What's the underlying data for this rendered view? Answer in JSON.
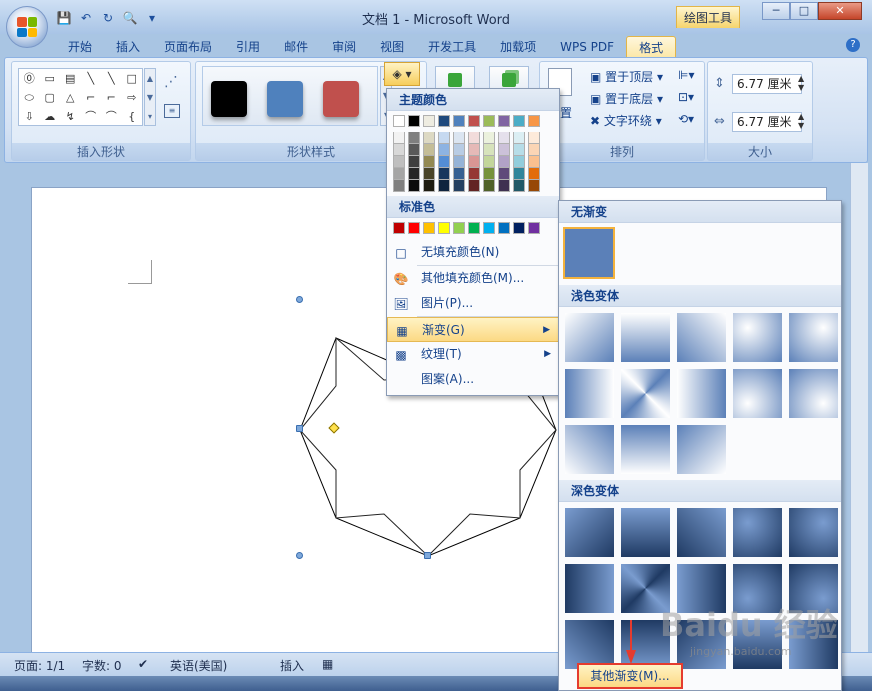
{
  "window": {
    "title": "文档 1 - Microsoft Word",
    "context_tool": "绘图工具",
    "btn_min": "─",
    "btn_max": "□",
    "btn_close": "✕"
  },
  "quick_access": [
    {
      "name": "save-icon",
      "glyph": "💾"
    },
    {
      "name": "undo-icon",
      "glyph": "↶"
    },
    {
      "name": "redo-icon",
      "glyph": "↻"
    },
    {
      "name": "print-preview-icon",
      "glyph": "🔍"
    },
    {
      "name": "qat-dropdown-icon",
      "glyph": "▾"
    }
  ],
  "tabs": [
    {
      "label": "开始",
      "active": false
    },
    {
      "label": "插入",
      "active": false
    },
    {
      "label": "页面布局",
      "active": false
    },
    {
      "label": "引用",
      "active": false
    },
    {
      "label": "邮件",
      "active": false
    },
    {
      "label": "审阅",
      "active": false
    },
    {
      "label": "视图",
      "active": false
    },
    {
      "label": "开发工具",
      "active": false
    },
    {
      "label": "加载项",
      "active": false
    },
    {
      "label": "WPS PDF",
      "active": false
    },
    {
      "label": "格式",
      "active": true
    }
  ],
  "help_label": "?",
  "ribbon": {
    "insert_shapes_label": "插入形状",
    "shape_styles_label": "形状样式",
    "arrange_label": "排列",
    "size_label": "大小",
    "shape_glyphs": [
      "⓪",
      "▭",
      "▤",
      "╲",
      "╲",
      "□",
      "⬭",
      "▢",
      "△",
      "⌐",
      "⌐",
      "⇨",
      "⇩",
      "☁",
      "↯",
      "⌒",
      "⌒",
      "{"
    ],
    "style_colors": [
      "#000000",
      "#4f81bd",
      "#c0504d"
    ],
    "bring_front": "置于顶层",
    "send_back": "置于底层",
    "text_wrap": "文字环绕",
    "position_partial": "置",
    "height_value": "6.77 厘米",
    "width_value": "6.77 厘米",
    "fill_btn_glyph": "◈ ▾"
  },
  "fill_menu": {
    "theme_colors_label": "主题颜色",
    "standard_colors_label": "标准色",
    "theme_top_row": [
      "#ffffff",
      "#000000",
      "#eeece1",
      "#1f497d",
      "#4f81bd",
      "#c0504d",
      "#9bbb59",
      "#8064a2",
      "#4bacc6",
      "#f79646"
    ],
    "theme_shades": [
      [
        "#f2f2f2",
        "#7f7f7f",
        "#ddd9c3",
        "#c6d9f0",
        "#dbe5f1",
        "#f2dcdb",
        "#ebf1dd",
        "#e5e0ec",
        "#dbeef3",
        "#fdeada"
      ],
      [
        "#d8d8d8",
        "#595959",
        "#c4bd97",
        "#8db3e2",
        "#b8cce4",
        "#e5b9b7",
        "#d7e3bc",
        "#ccc1d9",
        "#b7dde8",
        "#fbd5b5"
      ],
      [
        "#bfbfbf",
        "#3f3f3f",
        "#938953",
        "#548dd4",
        "#95b3d7",
        "#d99694",
        "#c3d69b",
        "#b2a2c7",
        "#92cddc",
        "#fac08f"
      ],
      [
        "#a5a5a5",
        "#262626",
        "#494429",
        "#17365d",
        "#366092",
        "#953734",
        "#76923c",
        "#5f497a",
        "#31859b",
        "#e36c09"
      ],
      [
        "#7f7f7f",
        "#0c0c0c",
        "#1d1b10",
        "#0f243e",
        "#244061",
        "#632423",
        "#4f6128",
        "#3f3151",
        "#205867",
        "#974806"
      ]
    ],
    "standard_colors": [
      "#c00000",
      "#ff0000",
      "#ffc000",
      "#ffff00",
      "#92d050",
      "#00b050",
      "#00b0f0",
      "#0070c0",
      "#002060",
      "#7030a0"
    ],
    "items": [
      {
        "label": "无填充颜色(N)",
        "icon": "no-fill-icon",
        "glyph": "□",
        "highlight": false,
        "submenu": false
      },
      {
        "label": "其他填充颜色(M)...",
        "icon": "palette-icon",
        "glyph": "🎨",
        "highlight": false,
        "submenu": false
      },
      {
        "label": "图片(P)...",
        "icon": "picture-icon",
        "glyph": "🖼",
        "highlight": false,
        "submenu": false
      },
      {
        "label": "渐变(G)",
        "icon": "gradient-icon",
        "glyph": "▦",
        "highlight": true,
        "submenu": true
      },
      {
        "label": "纹理(T)",
        "icon": "texture-icon",
        "glyph": "▩",
        "highlight": false,
        "submenu": true
      },
      {
        "label": "图案(A)...",
        "icon": "pattern-icon",
        "glyph": "",
        "highlight": false,
        "submenu": false
      }
    ]
  },
  "gradient_menu": {
    "no_gradient_label": "无渐变",
    "light_variations_label": "浅色变体",
    "dark_variations_label": "深色变体",
    "more_gradients_label": "其他渐变(M)..."
  },
  "status": {
    "page": "页面: 1/1",
    "words": "字数: 0",
    "language": "英语(美国)",
    "mode": "插入"
  },
  "watermark": {
    "brand": "Baidu 经验",
    "url": "jingyan.baidu.com"
  }
}
